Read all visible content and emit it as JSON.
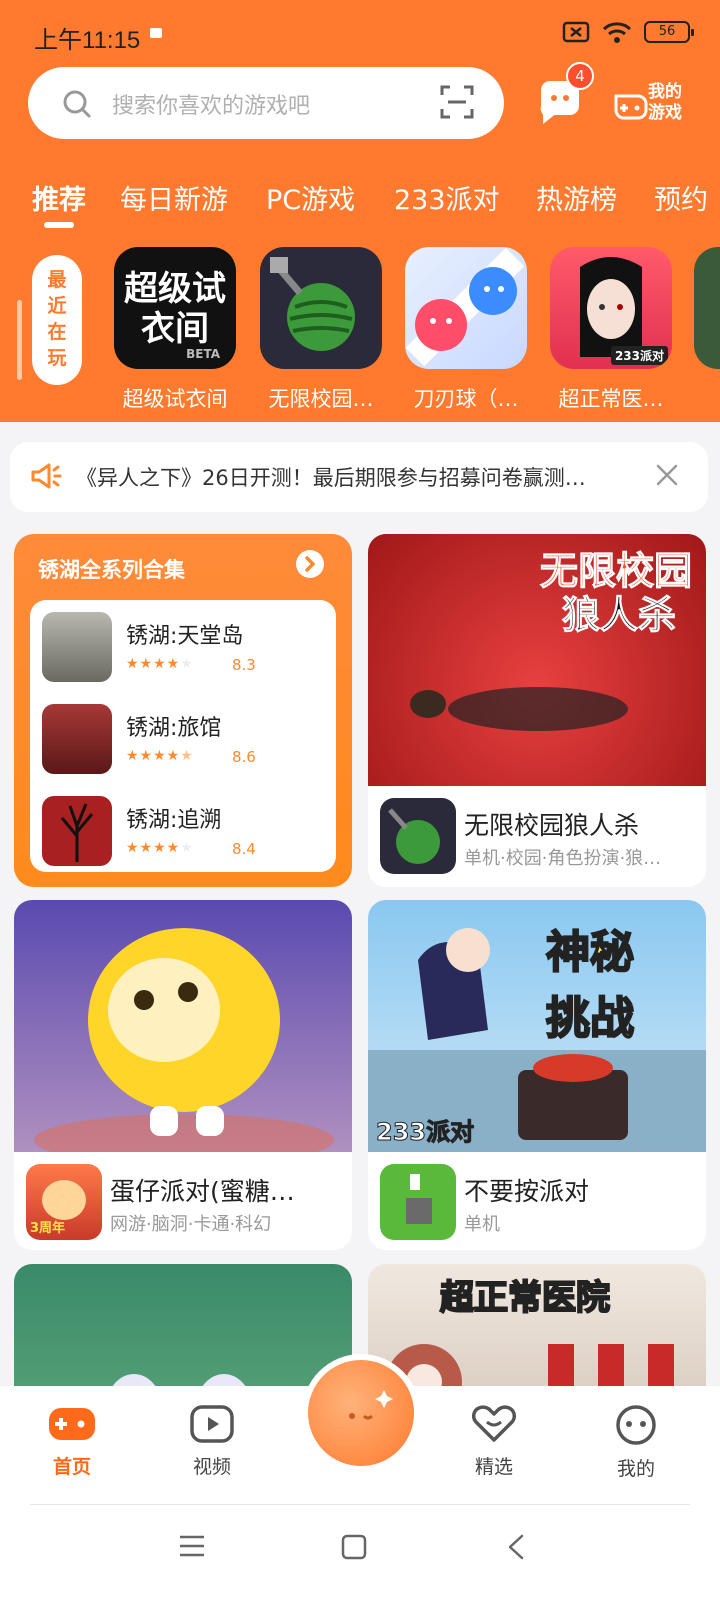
{
  "status_bar": {
    "time": "上午11:15",
    "battery": "56"
  },
  "search": {
    "placeholder": "搜索你喜欢的游戏吧"
  },
  "messages": {
    "badge_count": "4"
  },
  "my_games": {
    "label": "我的游戏"
  },
  "tabs": [
    {
      "label": "推荐",
      "active": true
    },
    {
      "label": "每日新游"
    },
    {
      "label": "PC游戏"
    },
    {
      "label": "233派对"
    },
    {
      "label": "热游榜"
    },
    {
      "label": "预约"
    }
  ],
  "recent": {
    "label": "最近在玩",
    "games": [
      {
        "name": "超级试衣间",
        "icon_text": "超级试衣间",
        "icon_badge": "BETA"
      },
      {
        "name": "无限校园…",
        "icon": "watermelon-icon"
      },
      {
        "name": "刀刃球（…",
        "icon": "blade-ball-icon"
      },
      {
        "name": "超正常医…",
        "icon_badge": "233派对"
      }
    ]
  },
  "notice": {
    "text": "《异人之下》26日开测！最后期限参与招募问卷赢测…"
  },
  "collection": {
    "title": "锈湖全系列合集",
    "items": [
      {
        "name": "锈湖:天堂岛",
        "score": "8.3",
        "stars": 4
      },
      {
        "name": "锈湖:旅馆",
        "score": "8.6",
        "stars": 4.5
      },
      {
        "name": "锈湖:追溯",
        "score": "8.4",
        "stars": 4
      }
    ]
  },
  "cards": [
    {
      "banner_title": "无限校园",
      "banner_sub": "狼人杀",
      "name": "无限校园狼人杀",
      "tags": "单机·校园·角色扮演·狼…"
    },
    {
      "name": "蛋仔派对(蜜糖…",
      "tags": "网游·脑洞·卡通·科幻",
      "icon_badge": "3周年"
    },
    {
      "banner_title": "神秘",
      "banner_sub": "挑战",
      "banner_badge": "233派对",
      "name": "不要按派对",
      "tags": "单机"
    },
    {
      "banner_title": "超正常医院"
    }
  ],
  "bottom_nav": [
    {
      "label": "首页",
      "active": true
    },
    {
      "label": "视频"
    },
    {
      "label": "精选"
    },
    {
      "label": "我的"
    }
  ]
}
